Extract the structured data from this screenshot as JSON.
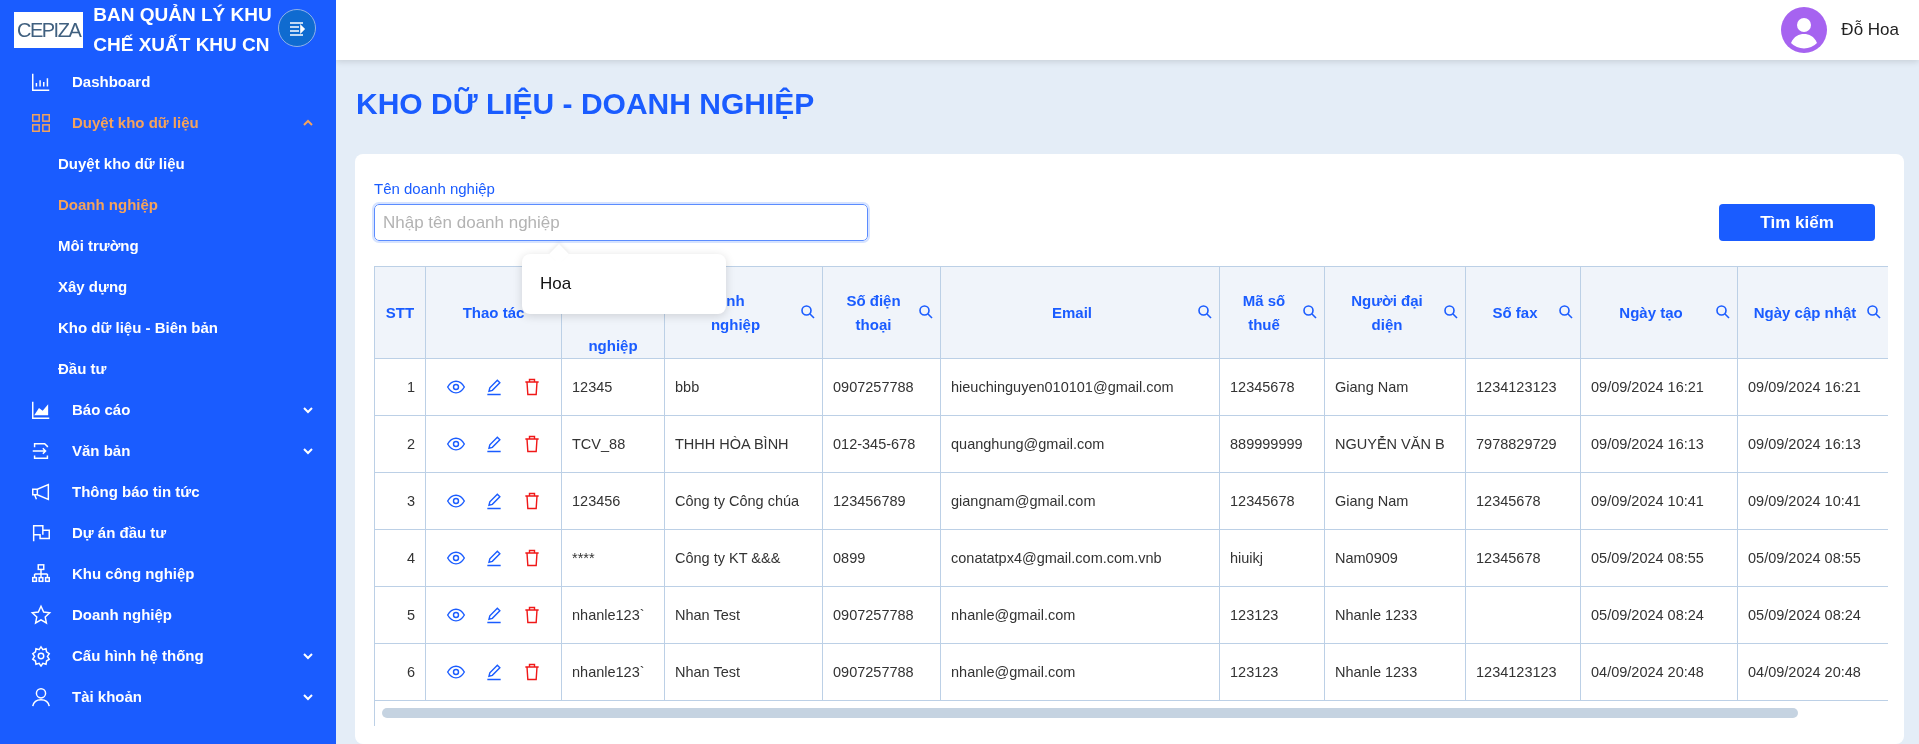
{
  "sidebar": {
    "logo": "CEPIZA",
    "title_lines": [
      "BAN QUẢN LÝ KHU",
      "CHẾ XUẤT KHU CN"
    ],
    "items": [
      {
        "label": "Dashboard",
        "selected": false
      },
      {
        "label": "Duyệt kho dữ liệu",
        "selected": true,
        "expanded": true,
        "children": [
          {
            "label": "Duyệt kho dữ liệu",
            "selected": false
          },
          {
            "label": "Doanh nghiệp",
            "selected": true
          },
          {
            "label": "Môi trường",
            "selected": false
          },
          {
            "label": "Xây dựng",
            "selected": false
          },
          {
            "label": "Kho dữ liệu - Biên bản",
            "selected": false
          },
          {
            "label": "Đầu tư",
            "selected": false
          }
        ]
      },
      {
        "label": "Báo cáo",
        "selected": false,
        "expanded": false
      },
      {
        "label": "Văn bản",
        "selected": false,
        "expanded": false
      },
      {
        "label": "Thông báo tin tức",
        "selected": false
      },
      {
        "label": "Dự án đầu tư",
        "selected": false
      },
      {
        "label": "Khu công nghiệp",
        "selected": false
      },
      {
        "label": "Doanh nghiệp",
        "selected": false
      },
      {
        "label": "Cấu hình hệ thống",
        "selected": false,
        "expanded": false
      },
      {
        "label": "Tài khoản",
        "selected": false,
        "expanded": false
      }
    ]
  },
  "header": {
    "user_name": "Đỗ Hoa"
  },
  "page_title": "KHO DỮ LIỆU - DOANH NGHIỆP",
  "search": {
    "label": "Tên doanh nghiệp",
    "placeholder": "Nhập tên doanh nghiệp",
    "button": "Tìm kiếm",
    "suggestions": [
      "Hoa"
    ]
  },
  "table": {
    "columns": [
      {
        "label": "STT",
        "kind": "text",
        "searchable": false
      },
      {
        "label": "Thao tác",
        "kind": "actions",
        "searchable": false
      },
      {
        "label": "nghiệp",
        "kind": "text",
        "searchable": false
      },
      {
        "label": "nh\nnghiệp",
        "kind": "text",
        "searchable": true
      },
      {
        "label": "Số điện\nthoại",
        "kind": "text",
        "searchable": true
      },
      {
        "label": "Email",
        "kind": "text",
        "searchable": true
      },
      {
        "label": "Mã số\nthuế",
        "kind": "text",
        "searchable": true
      },
      {
        "label": "Người đại\ndiện",
        "kind": "text",
        "searchable": true
      },
      {
        "label": "Số fax",
        "kind": "text",
        "searchable": true
      },
      {
        "label": "Ngày tạo",
        "kind": "text",
        "searchable": true
      },
      {
        "label": "Ngày cập nhật",
        "kind": "text",
        "searchable": true
      }
    ],
    "rows": [
      [
        "1",
        "",
        "12345",
        "bbb",
        "0907257788",
        "hieuchinguyen010101@gmail.com",
        "12345678",
        "Giang Nam",
        "1234123123",
        "09/09/2024 16:21",
        "09/09/2024 16:21"
      ],
      [
        "2",
        "",
        "TCV_88",
        "THHH HÒA BÌNH",
        "012-345-678",
        "quanghung@gmail.com",
        "889999999",
        "NGUYỄN VĂN B",
        "7978829729",
        "09/09/2024 16:13",
        "09/09/2024 16:13"
      ],
      [
        "3",
        "",
        "123456",
        "Công ty Công chúa",
        "123456789",
        "giangnam@gmail.com",
        "12345678",
        "Giang Nam",
        "12345678",
        "09/09/2024 10:41",
        "09/09/2024 10:41"
      ],
      [
        "4",
        "",
        "****",
        "Công ty KT &&&",
        "0899",
        "conatatpx4@gmail.com.com.vnb",
        "hiuikj",
        "Nam0909",
        "12345678",
        "05/09/2024 08:55",
        "05/09/2024 08:55"
      ],
      [
        "5",
        "",
        "nhanle123`",
        "Nhan Test",
        "0907257788",
        "nhanle@gmail.com",
        "123123",
        "Nhanle 1233",
        "",
        "05/09/2024 08:24",
        "05/09/2024 08:24"
      ],
      [
        "6",
        "",
        "nhanle123`",
        "Nhan Test",
        "0907257788",
        "nhanle@gmail.com",
        "123123",
        "Nhanle 1233",
        "1234123123",
        "04/09/2024 20:48",
        "04/09/2024 20:48"
      ]
    ]
  }
}
